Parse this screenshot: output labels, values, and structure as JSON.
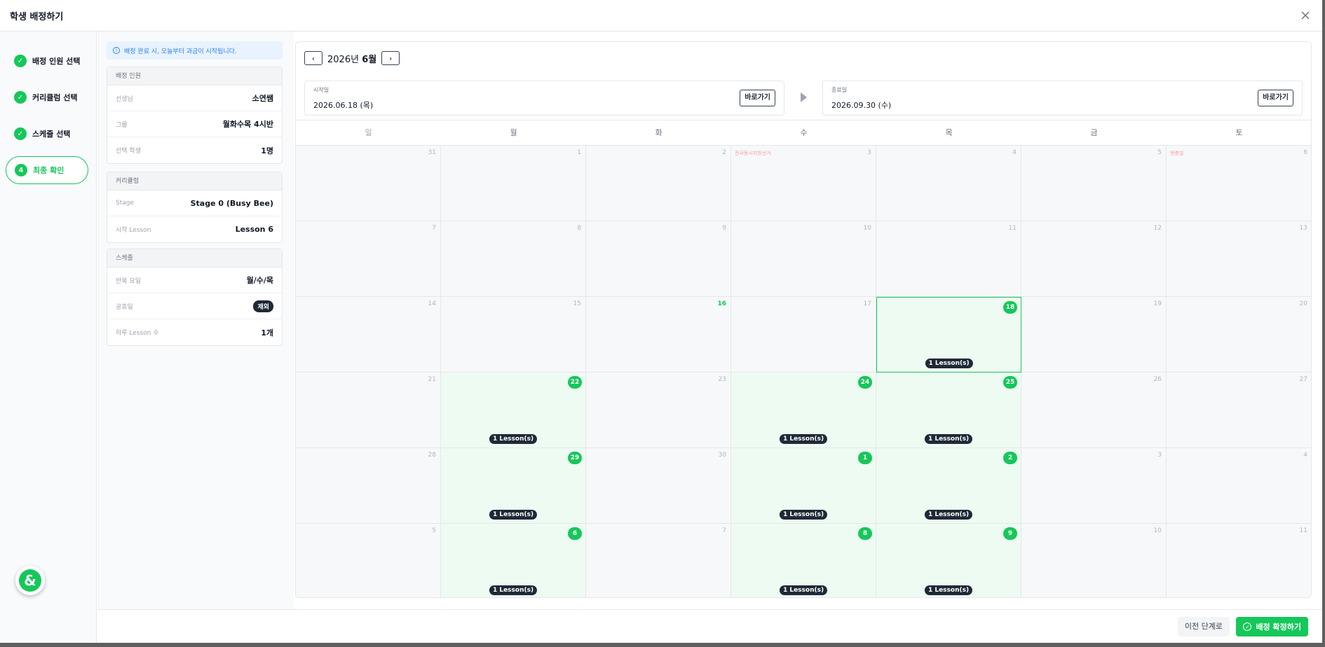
{
  "modal": {
    "title": "학생 배정하기"
  },
  "steps": [
    {
      "index": "1",
      "label": "배정 인원 선택",
      "status": "done"
    },
    {
      "index": "2",
      "label": "커리큘럼 선택",
      "status": "done"
    },
    {
      "index": "3",
      "label": "스케줄 선택",
      "status": "done"
    },
    {
      "index": "4",
      "label": "최종 확인",
      "status": "active"
    }
  ],
  "notice": "배정 완료 시, 오늘부터 과금이 시작됩니다.",
  "summary": {
    "assignee": {
      "title": "배정 인원",
      "rows": [
        {
          "key": "선생님",
          "value": "소연쌤"
        },
        {
          "key": "그룹",
          "value": "월화수목 4시반"
        },
        {
          "key": "선택 학생",
          "value": "1명"
        }
      ]
    },
    "curriculum": {
      "title": "커리큘럼",
      "rows": [
        {
          "key": "Stage",
          "value": "Stage 0 (Busy Bee)"
        },
        {
          "key": "시작 Lesson",
          "value": "Lesson 6"
        }
      ]
    },
    "schedule": {
      "title": "스케줄",
      "rows": [
        {
          "key": "반복 요일",
          "value": "월/수/목"
        },
        {
          "key": "공휴일",
          "value": "제외"
        },
        {
          "key": "하루 Lesson 수",
          "value": "1개"
        }
      ]
    }
  },
  "calendar": {
    "year_label": "2026년",
    "month_label": "6월",
    "start": {
      "label": "시작일",
      "value": "2026.06.18 (목)",
      "goto": "바로가기"
    },
    "end": {
      "label": "종료일",
      "value": "2026.09.30 (수)",
      "goto": "바로가기"
    },
    "weekdays": [
      "일",
      "월",
      "화",
      "수",
      "목",
      "금",
      "토"
    ],
    "lesson_label": "1 Lesson(s)",
    "weeks": [
      [
        {
          "d": "31"
        },
        {
          "d": "1"
        },
        {
          "d": "2"
        },
        {
          "d": "3",
          "holiday": "전국동시지방선거"
        },
        {
          "d": "4"
        },
        {
          "d": "5"
        },
        {
          "d": "6",
          "holiday": "현충일"
        }
      ],
      [
        {
          "d": "7"
        },
        {
          "d": "8"
        },
        {
          "d": "9"
        },
        {
          "d": "10"
        },
        {
          "d": "11"
        },
        {
          "d": "12"
        },
        {
          "d": "13"
        }
      ],
      [
        {
          "d": "14"
        },
        {
          "d": "15"
        },
        {
          "d": "16",
          "today": true
        },
        {
          "d": "17"
        },
        {
          "d": "18",
          "lesson": true,
          "selected": true
        },
        {
          "d": "19"
        },
        {
          "d": "20"
        }
      ],
      [
        {
          "d": "21"
        },
        {
          "d": "22",
          "lesson": true
        },
        {
          "d": "23"
        },
        {
          "d": "24",
          "lesson": true
        },
        {
          "d": "25",
          "lesson": true
        },
        {
          "d": "26"
        },
        {
          "d": "27"
        }
      ],
      [
        {
          "d": "28"
        },
        {
          "d": "29",
          "lesson": true
        },
        {
          "d": "30"
        },
        {
          "d": "1",
          "lesson": true
        },
        {
          "d": "2",
          "lesson": true
        },
        {
          "d": "3"
        },
        {
          "d": "4"
        }
      ],
      [
        {
          "d": "5"
        },
        {
          "d": "6",
          "lesson": true
        },
        {
          "d": "7"
        },
        {
          "d": "8",
          "lesson": true
        },
        {
          "d": "9",
          "lesson": true
        },
        {
          "d": "10"
        },
        {
          "d": "11"
        }
      ]
    ]
  },
  "footer": {
    "prev": "이전 단계로",
    "confirm": "배정 확정하기"
  },
  "colors": {
    "accent": "#16c75a",
    "dark_pill": "#1f2937",
    "notice_bg": "#e8f3ff",
    "notice_text": "#2f80ed"
  },
  "icons": {
    "close": "close-icon",
    "check": "check-icon",
    "chat": "chat-ampersand-icon",
    "info": "info-icon"
  }
}
